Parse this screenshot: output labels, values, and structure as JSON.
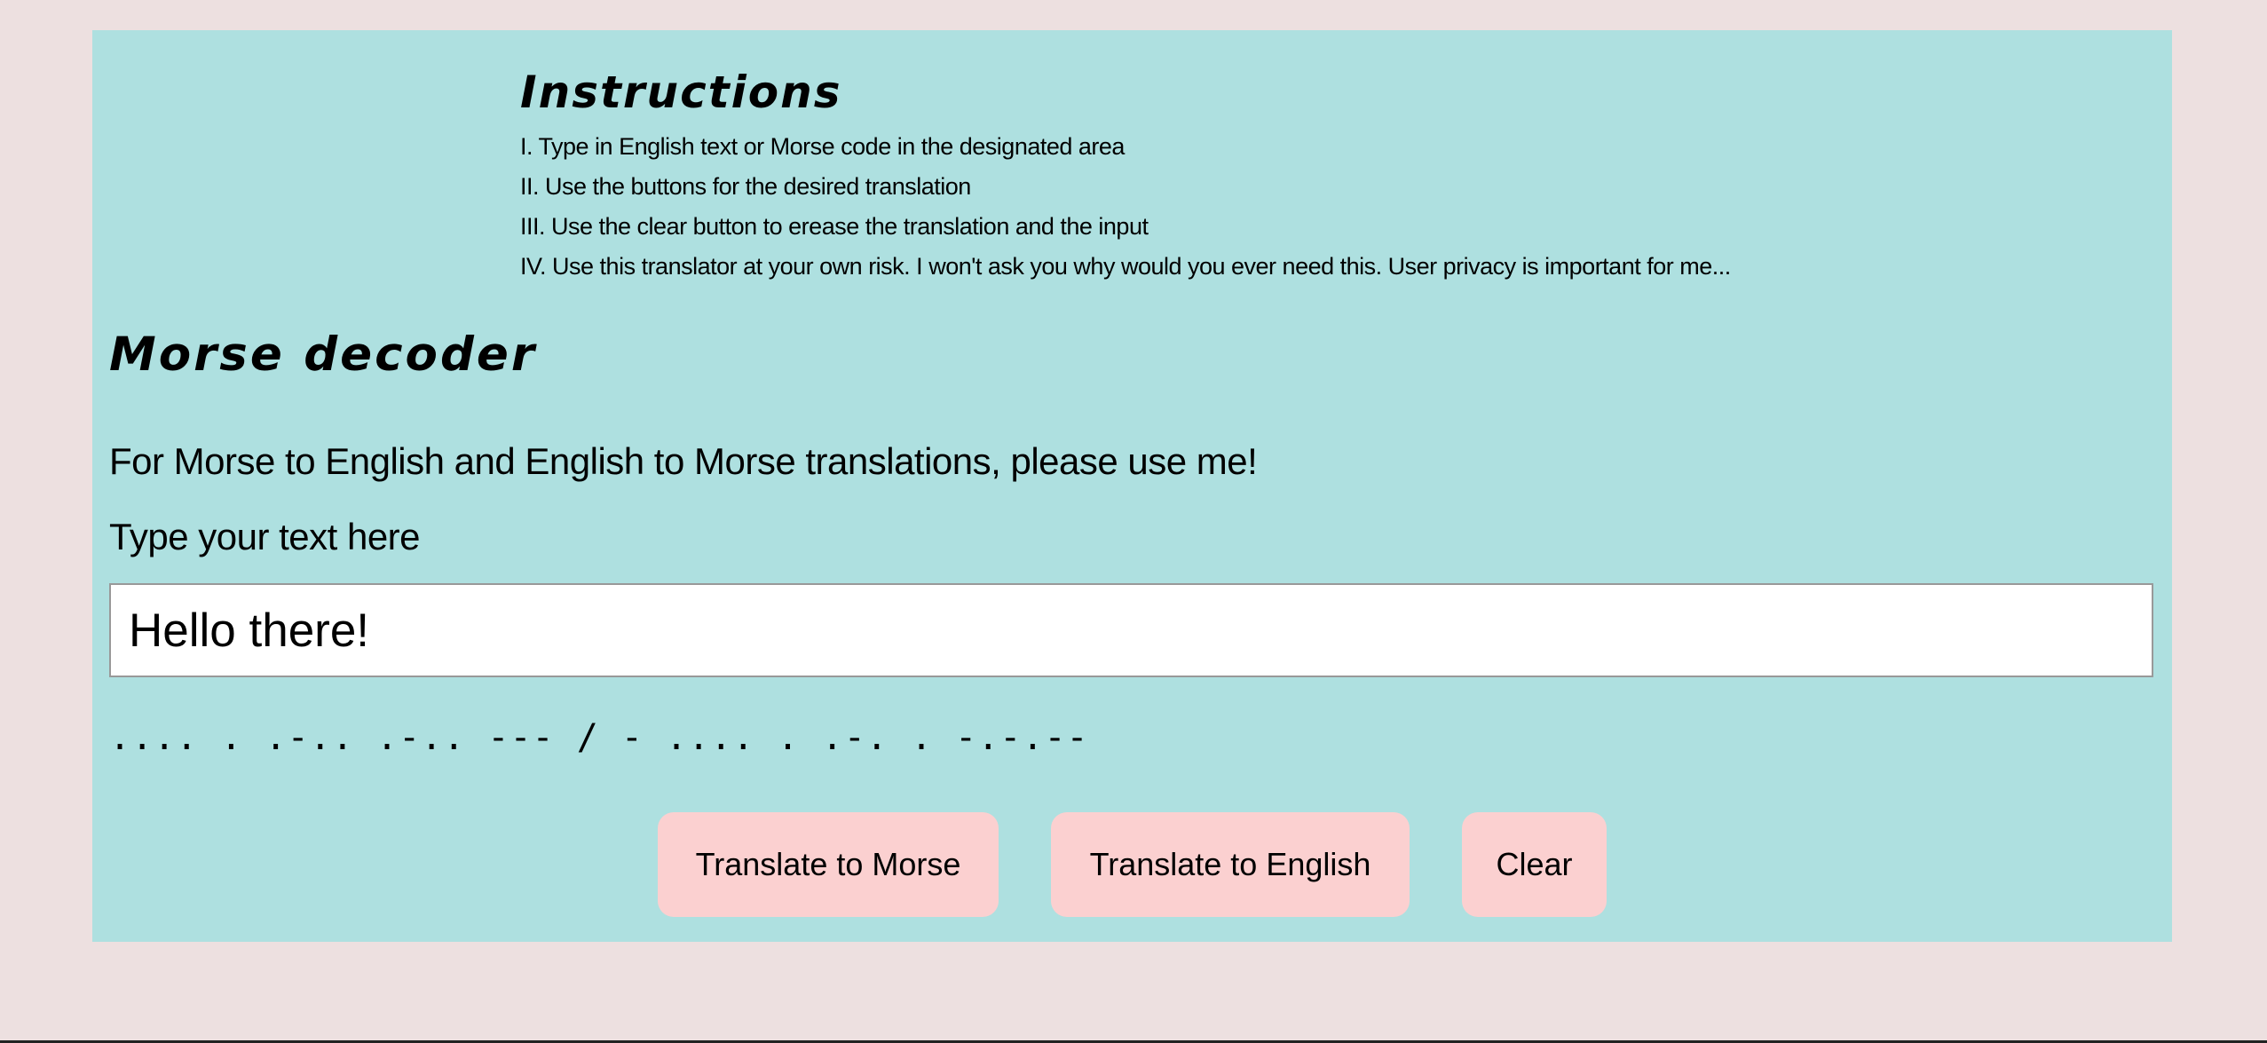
{
  "instructions": {
    "heading": "Instructions",
    "items": [
      "I. Type in English text or Morse code in the designated area",
      "II. Use the buttons for the desired translation",
      "III. Use the clear button to erease the translation and the input",
      "IV. Use this translator at your own risk. I won't ask you why would you ever need this. User privacy is important for me..."
    ]
  },
  "main": {
    "title": "Morse decoder",
    "subtitle": "For Morse to English and English to Morse translations, please use me!",
    "input_label": "Type your text here",
    "input_value": "Hello there!",
    "output": ".... . .-.. .-.. --- / - .... . .-. . -.-.--"
  },
  "buttons": {
    "to_morse": "Translate to Morse",
    "to_english": "Translate to English",
    "clear": "Clear"
  },
  "colors": {
    "page_background": "#ede0e0",
    "panel_background": "#aee0e0",
    "button_background": "#fbd0d0"
  }
}
